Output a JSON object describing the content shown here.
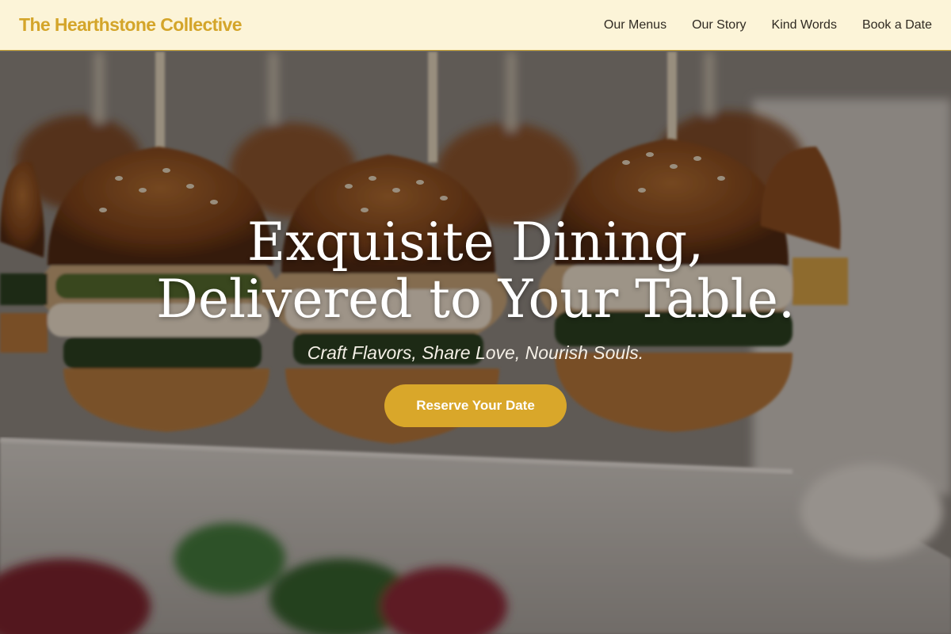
{
  "header": {
    "brand": "The Hearthstone Collective",
    "nav": [
      {
        "label": "Our Menus"
      },
      {
        "label": "Our Story"
      },
      {
        "label": "Kind Words"
      },
      {
        "label": "Book a Date"
      }
    ]
  },
  "hero": {
    "title_line1": "Exquisite Dining,",
    "title_line2": "Delivered to Your Table.",
    "subtitle": "Craft Flavors, Share Love, Nourish Souls.",
    "cta_label": "Reserve Your Date",
    "image_description": ""
  },
  "colors": {
    "header_bg": "#fcf4d8",
    "brand": "#d4a52a",
    "accent": "#d9a72a",
    "nav_text": "#2f2a22",
    "hero_text": "#ffffff"
  }
}
